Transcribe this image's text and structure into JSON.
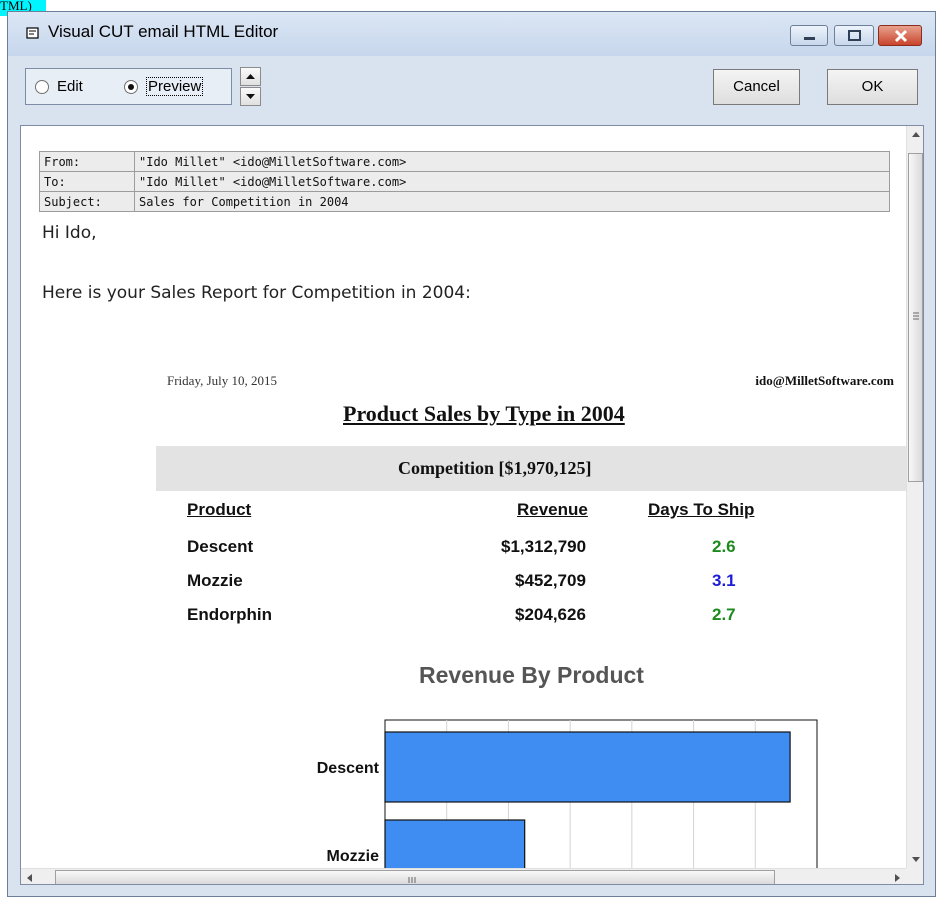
{
  "overlay_tag": "TML)",
  "window": {
    "title": "Visual CUT email HTML Editor",
    "buttons": {
      "minimize": "minimize-icon",
      "maximize": "maximize-icon",
      "close": "close-icon"
    }
  },
  "toolbar": {
    "mode_options": [
      {
        "label": "Edit",
        "selected": false
      },
      {
        "label": "Preview",
        "selected": true
      }
    ],
    "cancel_label": "Cancel",
    "ok_label": "OK"
  },
  "email": {
    "headers": [
      {
        "key": "From:",
        "value": "\"Ido Millet\" <ido@MilletSoftware.com>"
      },
      {
        "key": "To:",
        "value": "\"Ido Millet\" <ido@MilletSoftware.com>"
      },
      {
        "key": "Subject:",
        "value": "Sales for Competition in 2004"
      }
    ],
    "greeting": "Hi Ido,",
    "intro": "Here is your Sales Report for Competition in 2004:"
  },
  "report": {
    "date": "Friday, July 10, 2015",
    "email": "ido@MilletSoftware.com",
    "title": "Product Sales by Type in 2004",
    "group": "Competition  [$1,970,125]",
    "columns": [
      "Product",
      "Revenue",
      "Days To Ship"
    ],
    "rows": [
      {
        "product": "Descent",
        "revenue": "$1,312,790",
        "days": "2.6",
        "days_color": "#1e8a1e"
      },
      {
        "product": "Mozzie",
        "revenue": "$452,709",
        "days": "3.1",
        "days_color": "#1d1dd8"
      },
      {
        "product": "Endorphin",
        "revenue": "$204,626",
        "days": "2.7",
        "days_color": "#1e8a1e"
      }
    ]
  },
  "chart_data": {
    "type": "bar",
    "orientation": "horizontal",
    "title": "Revenue By Product",
    "categories": [
      "Descent",
      "Mozzie"
    ],
    "values": [
      1312790,
      452709
    ],
    "xlim": [
      0,
      1400000
    ],
    "grid": true,
    "bar_color": "#3f8cf2"
  },
  "colors": {
    "window_bg": "#d9e3f0",
    "group_band": "#e3e3e3",
    "bar_fill": "#3f8cf2"
  }
}
